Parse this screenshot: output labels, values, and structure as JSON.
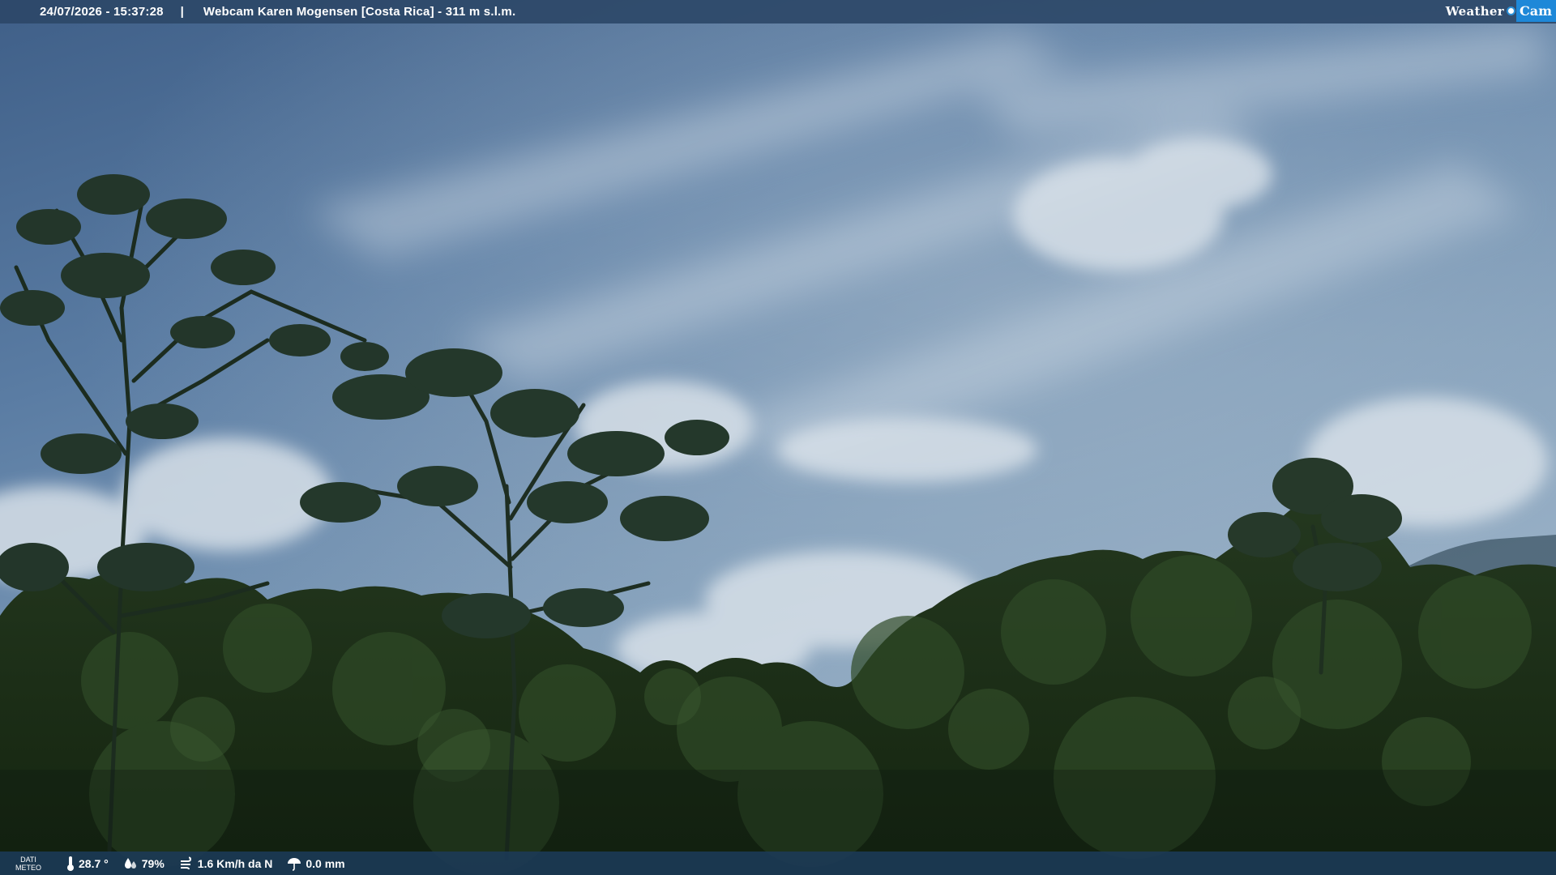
{
  "header": {
    "timestamp": "24/07/2026 - 15:37:28",
    "separator": "|",
    "title": "Webcam Karen Mogensen [Costa Rica] - 311 m s.l.m.",
    "logo_weather": "Weather",
    "logo_cam": "Cam"
  },
  "footer": {
    "dati_line1": "DATI",
    "dati_line2": "METEO",
    "temperature": "28.7 °",
    "humidity": "79%",
    "wind": "1.6 Km/h da N",
    "rain": "0.0 mm"
  },
  "colors": {
    "bar": "#2c4868",
    "logo_accent": "#1e88d8"
  },
  "icons": {
    "temperature": "thermometer-icon",
    "humidity": "humidity-drops-icon",
    "wind": "wind-icon",
    "rain": "umbrella-icon"
  }
}
